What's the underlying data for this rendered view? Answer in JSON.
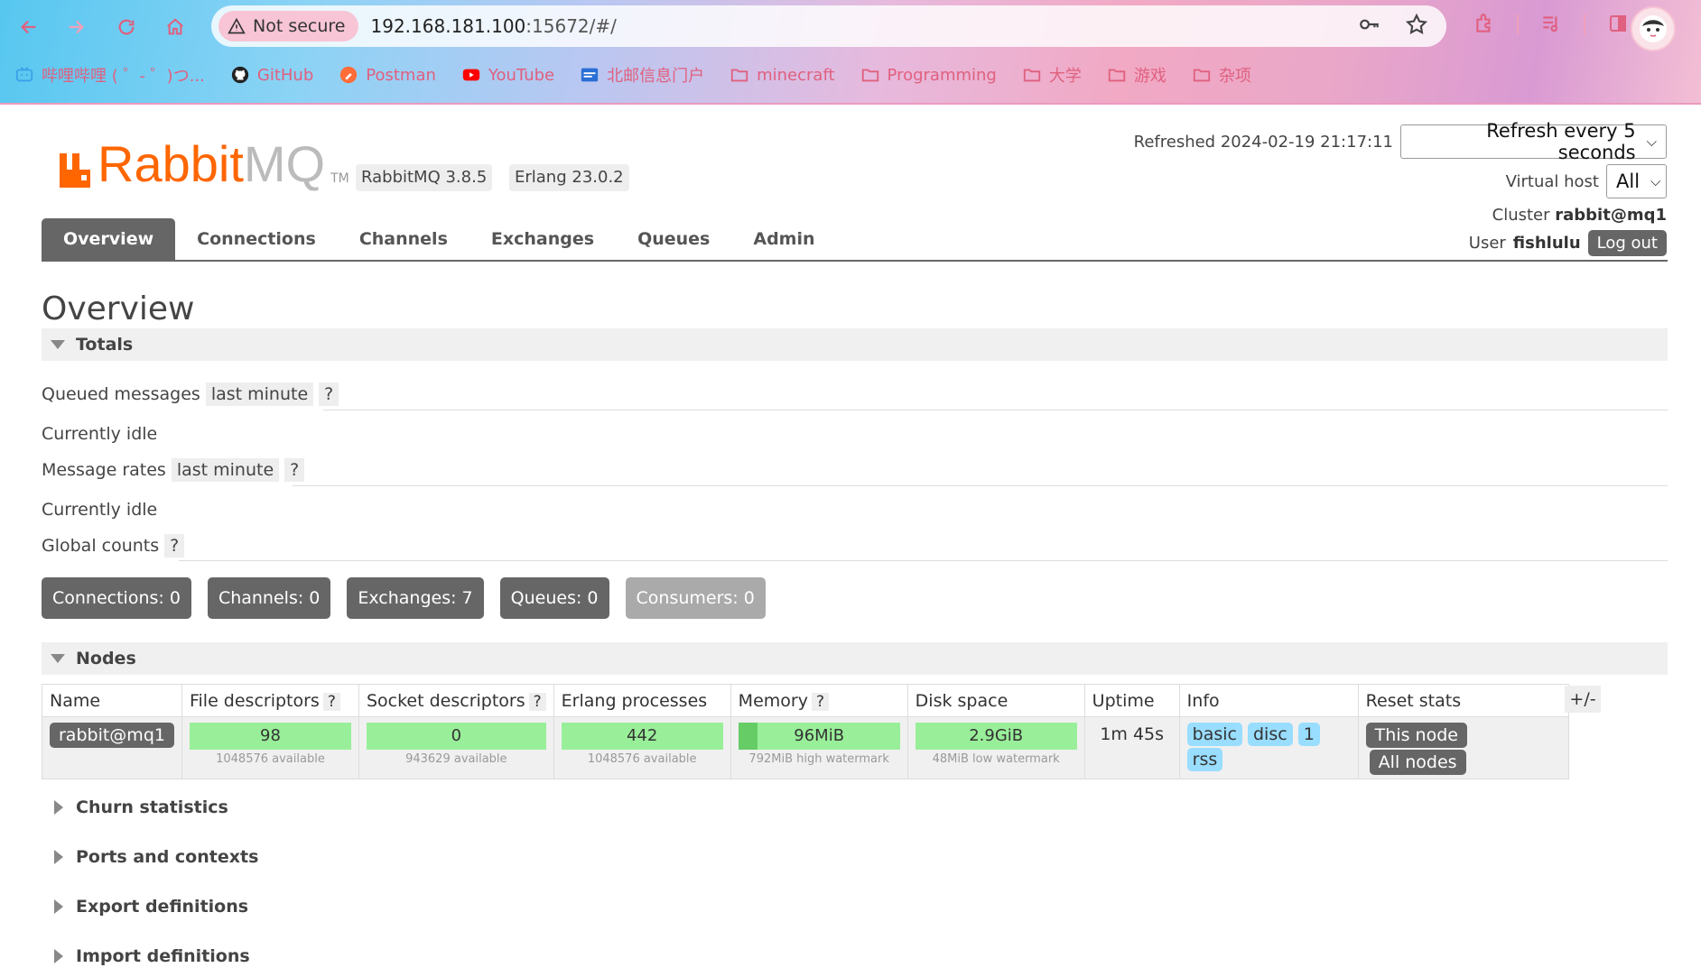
{
  "browser": {
    "security_label": "Not secure",
    "url_host": "192.168.181.100",
    "url_rest": ":15672/#/",
    "bookmarks": [
      {
        "label": "哔哩哔哩 ( ゜- ゜)つ...",
        "icon": "bilibili-icon"
      },
      {
        "label": "GitHub",
        "icon": "github-icon"
      },
      {
        "label": "Postman",
        "icon": "postman-icon"
      },
      {
        "label": "YouTube",
        "icon": "youtube-icon"
      },
      {
        "label": "北邮信息门户",
        "icon": "portal-icon"
      },
      {
        "label": "minecraft",
        "icon": "folder-icon"
      },
      {
        "label": "Programming",
        "icon": "folder-icon"
      },
      {
        "label": "大学",
        "icon": "folder-icon"
      },
      {
        "label": "游戏",
        "icon": "folder-icon"
      },
      {
        "label": "杂项",
        "icon": "folder-icon"
      }
    ]
  },
  "header": {
    "logo_rabbit": "Rabbit",
    "logo_mq": "MQ",
    "logo_tm": "TM",
    "rabbitmq_version": "RabbitMQ 3.8.5",
    "erlang_version": "Erlang 23.0.2",
    "refreshed_label": "Refreshed 2024-02-19 21:17:11",
    "refresh_select": "Refresh every 5 seconds",
    "vhost_label": "Virtual host",
    "vhost_value": "All",
    "cluster_label": "Cluster",
    "cluster_value": "rabbit@mq1",
    "user_label": "User",
    "user_value": "fishlulu",
    "logout_label": "Log out"
  },
  "tabs": [
    "Overview",
    "Connections",
    "Channels",
    "Exchanges",
    "Queues",
    "Admin"
  ],
  "page_title": "Overview",
  "totals": {
    "heading": "Totals",
    "queued_label": "Queued messages",
    "queued_range": "last minute",
    "help": "?",
    "queued_status": "Currently idle",
    "rates_label": "Message rates",
    "rates_range": "last minute",
    "rates_status": "Currently idle",
    "global_label": "Global counts",
    "counts": {
      "connections": "Connections: 0",
      "channels": "Channels: 0",
      "exchanges": "Exchanges: 7",
      "queues": "Queues: 0",
      "consumers": "Consumers: 0"
    }
  },
  "nodes": {
    "heading": "Nodes",
    "columns": [
      "Name",
      "File descriptors",
      "Socket descriptors",
      "Erlang processes",
      "Memory",
      "Disk space",
      "Uptime",
      "Info",
      "Reset stats"
    ],
    "plusminus": "+/-",
    "row": {
      "name": "rabbit@mq1",
      "file_desc": "98",
      "file_desc_sub": "1048576 available",
      "socket_desc": "0",
      "socket_desc_sub": "943629 available",
      "erlang_proc": "442",
      "erlang_proc_sub": "1048576 available",
      "memory": "96MiB",
      "memory_sub": "792MiB high watermark",
      "memory_fill_fraction": 0.12,
      "disk": "2.9GiB",
      "disk_sub": "48MiB low watermark",
      "uptime": "1m 45s",
      "info_tags": [
        "basic",
        "disc",
        "1",
        "rss"
      ],
      "reset_this": "This node",
      "reset_all": "All nodes"
    }
  },
  "collapsed_sections": [
    "Churn statistics",
    "Ports and contexts",
    "Export definitions",
    "Import definitions"
  ],
  "colors": {
    "accent": "#ff6600",
    "tab_active": "#666666",
    "bar_green": "#99ef99",
    "info_blue": "#99ddff"
  }
}
